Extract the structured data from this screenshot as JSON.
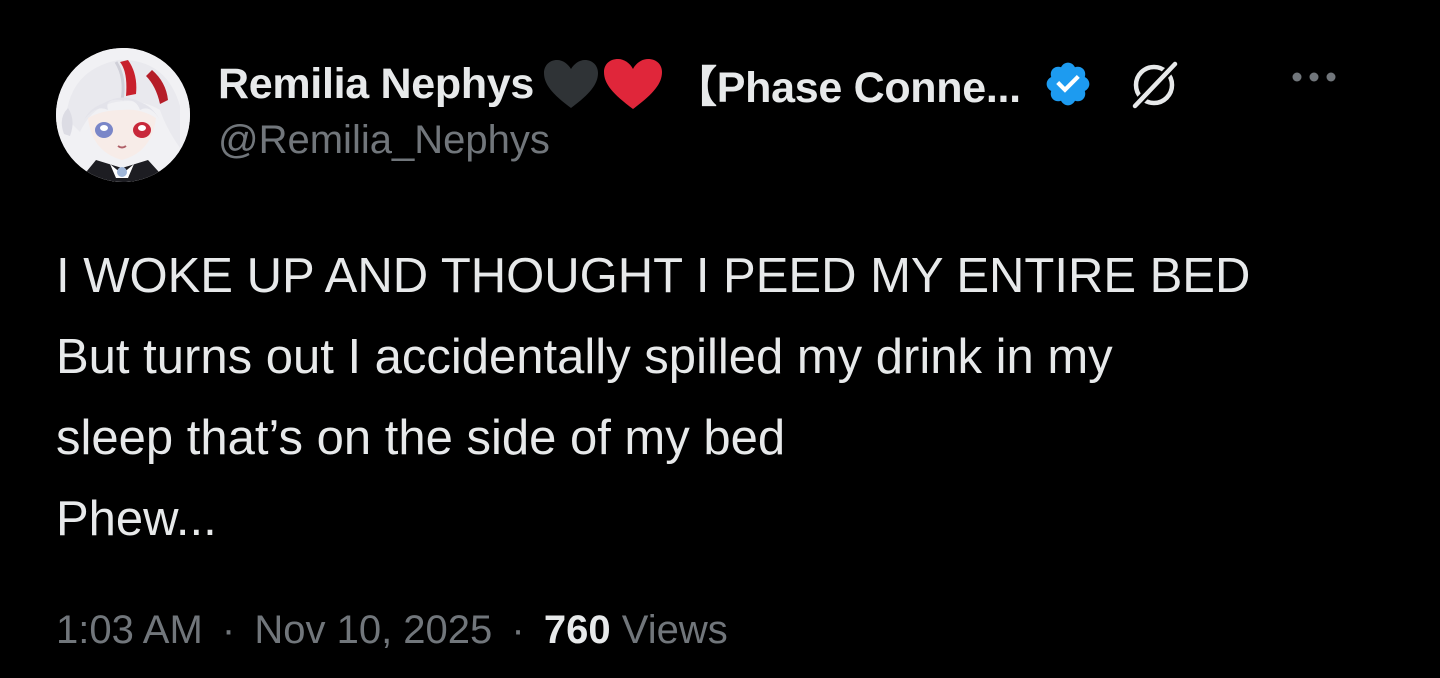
{
  "author": {
    "display_name": "Remilia Nephys",
    "affiliation": "【Phase Conne...",
    "handle": "@Remilia_Nephys",
    "avatar_icon": "anime-avatar",
    "hearts": [
      "black-heart-icon",
      "red-heart-icon"
    ],
    "verified_icon": "verified-badge-icon",
    "verified_color": "#1d9bf0"
  },
  "actions": {
    "grok_icon": "grok-icon",
    "more_icon": "more-options-icon"
  },
  "tweet": {
    "lines": [
      "I WOKE UP AND THOUGHT I PEED MY ENTIRE BED",
      "But turns out I accidentally spilled my drink in my",
      "sleep that’s on the side of my bed",
      "Phew..."
    ]
  },
  "meta": {
    "time": "1:03 AM",
    "separator": "·",
    "date": "Nov 10, 2025",
    "views_count": "760",
    "views_label": "Views"
  },
  "colors": {
    "background": "#000000",
    "primary_text": "#e7e9ea",
    "secondary_text": "#71767b",
    "heart_red": "#e0263a",
    "heart_black": "#2f3336"
  }
}
